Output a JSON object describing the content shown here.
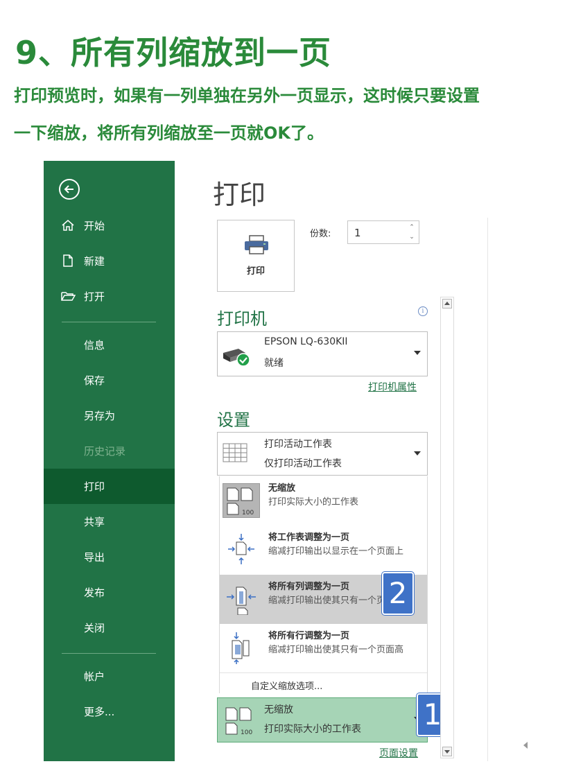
{
  "article": {
    "heading": "9、所有列缩放到一页",
    "intro_line1": "打印预览时，如果有一列单独在另外一页显示，这时候只要设置",
    "intro_line2": "一下缩放，将所有列缩放至一页就OK了。"
  },
  "sidebar": {
    "items": [
      {
        "label": "开始",
        "icon": "home-icon"
      },
      {
        "label": "新建",
        "icon": "new-document-icon"
      },
      {
        "label": "打开",
        "icon": "open-folder-icon"
      },
      {
        "label": "信息"
      },
      {
        "label": "保存"
      },
      {
        "label": "另存为"
      },
      {
        "label": "历史记录",
        "disabled": true
      },
      {
        "label": "打印",
        "active": true
      },
      {
        "label": "共享"
      },
      {
        "label": "导出"
      },
      {
        "label": "发布"
      },
      {
        "label": "关闭"
      },
      {
        "label": "帐户"
      },
      {
        "label": "更多..."
      }
    ]
  },
  "main": {
    "title": "打印",
    "print_button_label": "打印",
    "copies_label": "份数:",
    "copies_value": "1",
    "printer_section": "打印机",
    "printer_name": "EPSON LQ-630KII",
    "printer_status": "就绪",
    "printer_properties_link": "打印机属性",
    "settings_section": "设置",
    "print_what_title": "打印活动工作表",
    "print_what_desc": "仅打印活动工作表",
    "scaling_options": [
      {
        "title": "无缩放",
        "desc": "打印实际大小的工作表"
      },
      {
        "title": "将工作表调整为一页",
        "desc": "缩减打印输出以显示在一个页面上"
      },
      {
        "title": "将所有列调整为一页",
        "desc": "缩减打印输出使其只有一个页面宽"
      },
      {
        "title": "将所有行调整为一页",
        "desc": "缩减打印输出使其只有一个页面高"
      }
    ],
    "custom_scaling": "自定义缩放选项...",
    "selected_scaling_title": "无缩放",
    "selected_scaling_desc": "打印实际大小的工作表",
    "page_setup_link": "页面设置",
    "badge_1": "1",
    "badge_2": "2"
  },
  "colors": {
    "sidebar": "#217346",
    "sidebar_active": "#0e5a2e",
    "accent_green": "#2a8a3a",
    "selected_bg": "#a6d4b6",
    "highlight_bg": "#d0d0d0",
    "badge": "#3f72c7"
  }
}
